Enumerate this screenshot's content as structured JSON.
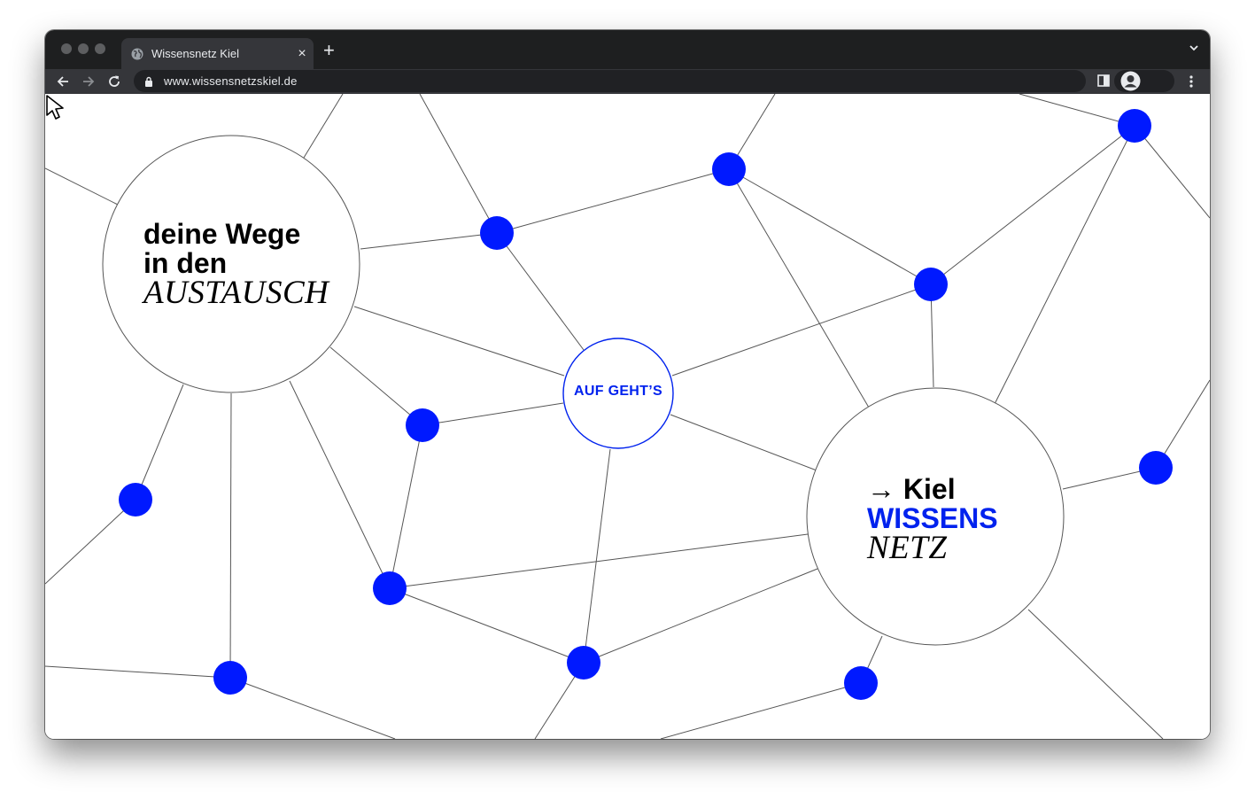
{
  "browser": {
    "tab_title": "Wissensnetz Kiel",
    "tab_close_glyph": "×",
    "new_tab_glyph": "+",
    "url": "www.wissensnetzskiel.de",
    "icons": [
      "globe-icon",
      "back-arrow-icon",
      "forward-arrow-icon",
      "reload-icon",
      "lock-icon",
      "sidebar-icon",
      "profile-icon",
      "kebab-menu-icon",
      "chevron-down-icon",
      "close-icon"
    ]
  },
  "hero": {
    "line1": "deine Wege",
    "line2": "in den",
    "line3": "AUSTAUSCH"
  },
  "cta": {
    "label": "AUF GEHT’S"
  },
  "brand": {
    "arrow": "→",
    "city": "Kiel",
    "word1": "WISSENS",
    "word2": "NETZ"
  },
  "colors": {
    "accent": "#0022ee",
    "node": "#0019ff",
    "line": "#555555",
    "chrome_dark": "#1e1f20",
    "chrome_tab": "#35363a"
  }
}
